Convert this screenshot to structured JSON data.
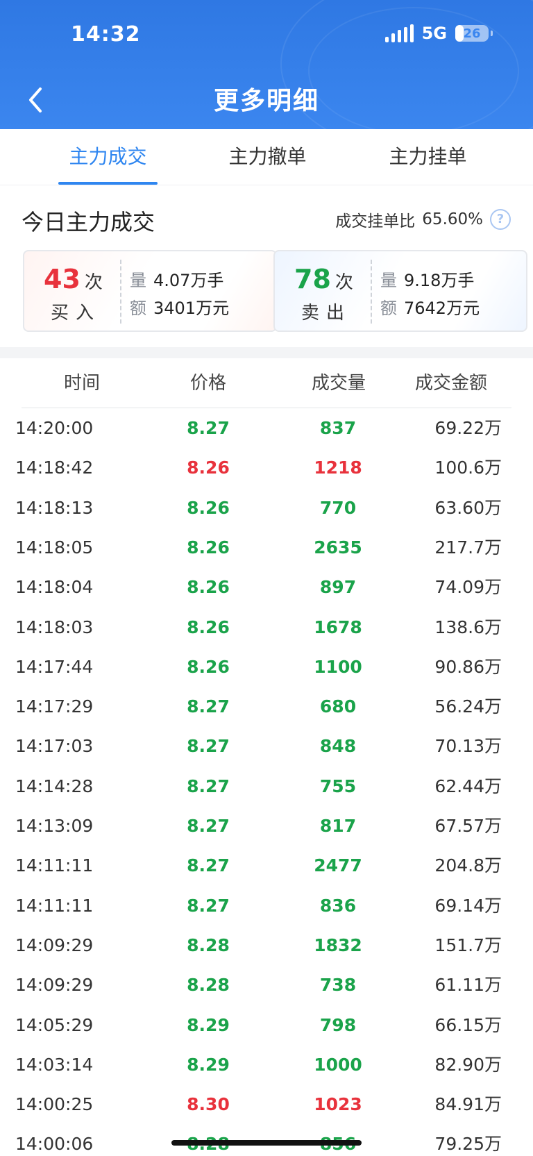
{
  "status_bar": {
    "time": "14:32",
    "network": "5G",
    "battery": "26",
    "battery_fraction": 0.26
  },
  "header": {
    "title": "更多明细"
  },
  "tabs": [
    {
      "label": "主力成交",
      "active": true
    },
    {
      "label": "主力撤单",
      "active": false
    },
    {
      "label": "主力挂单",
      "active": false
    }
  ],
  "summary": {
    "title": "今日主力成交",
    "ratio_label": "成交挂单比",
    "ratio_value": "65.60%",
    "buy": {
      "count": "43",
      "unit": "次",
      "side": "买入",
      "volume_label": "量",
      "volume": "4.07万手",
      "amount_label": "额",
      "amount": "3401万元"
    },
    "sell": {
      "count": "78",
      "unit": "次",
      "side": "卖出",
      "volume_label": "量",
      "volume": "9.18万手",
      "amount_label": "额",
      "amount": "7642万元"
    }
  },
  "table": {
    "headers": [
      "时间",
      "价格",
      "成交量",
      "成交金额"
    ],
    "rows": [
      {
        "time": "14:20:00",
        "price": "8.27",
        "volume": "837",
        "amount": "69.22万",
        "color": "green"
      },
      {
        "time": "14:18:42",
        "price": "8.26",
        "volume": "1218",
        "amount": "100.6万",
        "color": "red"
      },
      {
        "time": "14:18:13",
        "price": "8.26",
        "volume": "770",
        "amount": "63.60万",
        "color": "green"
      },
      {
        "time": "14:18:05",
        "price": "8.26",
        "volume": "2635",
        "amount": "217.7万",
        "color": "green"
      },
      {
        "time": "14:18:04",
        "price": "8.26",
        "volume": "897",
        "amount": "74.09万",
        "color": "green"
      },
      {
        "time": "14:18:03",
        "price": "8.26",
        "volume": "1678",
        "amount": "138.6万",
        "color": "green"
      },
      {
        "time": "14:17:44",
        "price": "8.26",
        "volume": "1100",
        "amount": "90.86万",
        "color": "green"
      },
      {
        "time": "14:17:29",
        "price": "8.27",
        "volume": "680",
        "amount": "56.24万",
        "color": "green"
      },
      {
        "time": "14:17:03",
        "price": "8.27",
        "volume": "848",
        "amount": "70.13万",
        "color": "green"
      },
      {
        "time": "14:14:28",
        "price": "8.27",
        "volume": "755",
        "amount": "62.44万",
        "color": "green"
      },
      {
        "time": "14:13:09",
        "price": "8.27",
        "volume": "817",
        "amount": "67.57万",
        "color": "green"
      },
      {
        "time": "14:11:11",
        "price": "8.27",
        "volume": "2477",
        "amount": "204.8万",
        "color": "green"
      },
      {
        "time": "14:11:11",
        "price": "8.27",
        "volume": "836",
        "amount": "69.14万",
        "color": "green"
      },
      {
        "time": "14:09:29",
        "price": "8.28",
        "volume": "1832",
        "amount": "151.7万",
        "color": "green"
      },
      {
        "time": "14:09:29",
        "price": "8.28",
        "volume": "738",
        "amount": "61.11万",
        "color": "green"
      },
      {
        "time": "14:05:29",
        "price": "8.29",
        "volume": "798",
        "amount": "66.15万",
        "color": "green"
      },
      {
        "time": "14:03:14",
        "price": "8.29",
        "volume": "1000",
        "amount": "82.90万",
        "color": "green"
      },
      {
        "time": "14:00:25",
        "price": "8.30",
        "volume": "1023",
        "amount": "84.91万",
        "color": "red"
      },
      {
        "time": "14:00:06",
        "price": "8.28",
        "volume": "856",
        "amount": "79.25万",
        "color": "green"
      }
    ]
  },
  "colors": {
    "accent": "#2f86f0",
    "up": "#e8323c",
    "down": "#1aa34a",
    "header_bg": "#3b86ef"
  }
}
